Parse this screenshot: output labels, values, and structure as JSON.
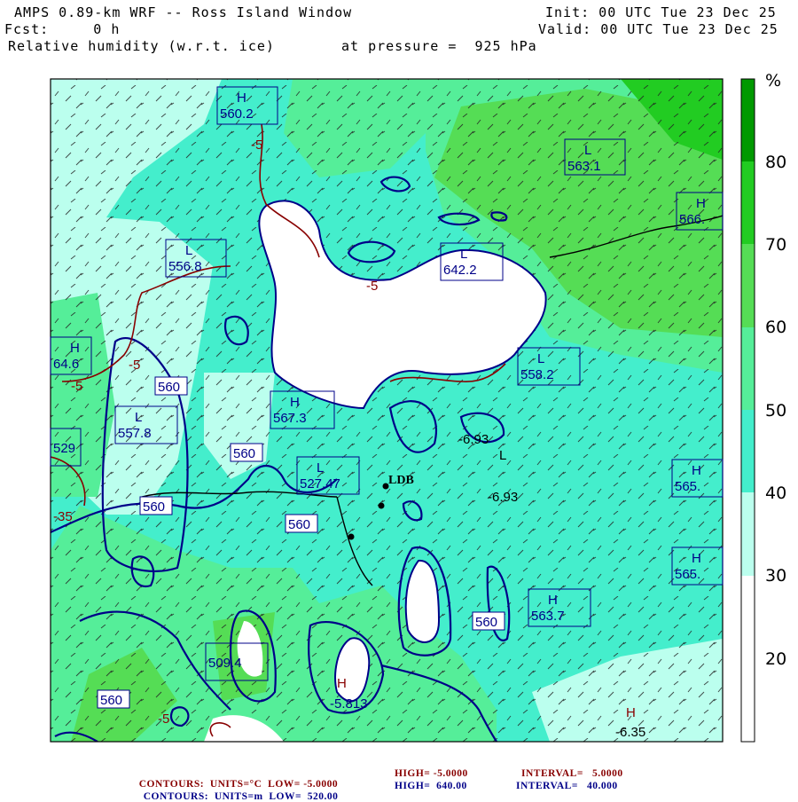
{
  "header": {
    "title": "AMPS 0.89-km WRF -- Ross Island Window",
    "init": "Init: 00 UTC Tue 23 Dec 25",
    "fcst": "Fcst:     0 h",
    "valid": "Valid: 00 UTC Tue 23 Dec 25",
    "field": "Relative humidity (w.r.t. ice)",
    "level": "at pressure =  925 hPa"
  },
  "colorbar": {
    "unit": "%",
    "labels": [
      "80",
      "70",
      "60",
      "50",
      "40",
      "30",
      "20"
    ],
    "colors": {
      "gt80": "#009900",
      "70_80": "#22cc22",
      "60_70": "#55dd55",
      "50_60": "#55ee99",
      "40_50": "#44eecc",
      "30_40": "#bbffee",
      "lt30": "#ffffff"
    }
  },
  "station": {
    "label": "LDB"
  },
  "map_labels": {
    "boxes": [
      {
        "letter": "H",
        "value": "560.2"
      },
      {
        "letter": "L",
        "value": "563.1"
      },
      {
        "letter": "H",
        "value": "566."
      },
      {
        "letter": "L",
        "value": "556.8"
      },
      {
        "letter": "L",
        "value": "642.2"
      },
      {
        "letter": "H",
        "value": "64.6"
      },
      {
        "letter": "L",
        "value": "558.2"
      },
      {
        "letter": "H",
        "value": "567.3"
      },
      {
        "letter": "L",
        "value": "557.8"
      },
      {
        "letter": "",
        "value": "529"
      },
      {
        "letter": "L",
        "value": "527.47"
      },
      {
        "letter": "H",
        "value": "565."
      },
      {
        "letter": "H",
        "value": "565."
      },
      {
        "letter": "H",
        "value": "563.7"
      },
      {
        "letter": "",
        "value": "509.4"
      }
    ],
    "contour_560": "560",
    "temp_labels": [
      "-5",
      "-5",
      "-5",
      "-5",
      "-5",
      "-35"
    ],
    "temp_values": [
      "-6.93",
      "-6.93",
      "-6.35",
      "-5.813"
    ],
    "h_markers": [
      "H",
      "H"
    ],
    "l_markers": [
      "L"
    ]
  },
  "footer": {
    "temp": {
      "prefix": "CONTOURS:",
      "units": "UNITS=°C",
      "low": "LOW= -5.0000",
      "high": "HIGH= -5.0000",
      "interval": "INTERVAL=   5.0000",
      "color": "#880000"
    },
    "height": {
      "prefix": "CONTOURS:",
      "units": "UNITS=m",
      "low": "LOW=  520.00",
      "high": "HIGH=  640.00",
      "interval": "INTERVAL=   40.000",
      "color": "#000088"
    }
  }
}
